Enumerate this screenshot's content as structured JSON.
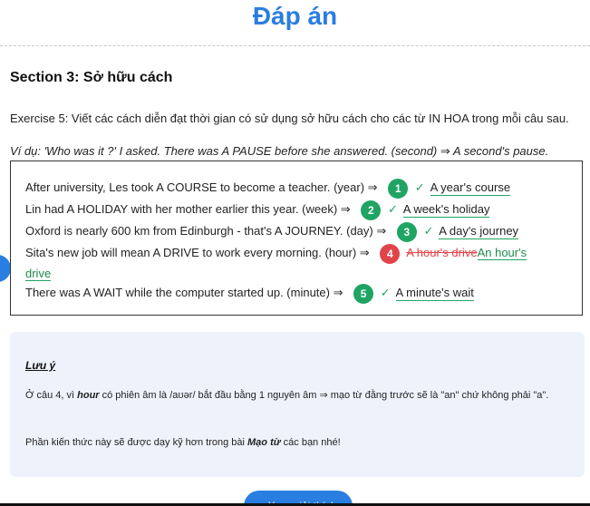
{
  "page": {
    "title": "Đáp án"
  },
  "section": {
    "title": "Section 3: Sở hữu cách"
  },
  "exercise": {
    "instruction": "Exercise 5: Viết các cách diễn đạt thời gian có sử dụng sở hữu cách cho các từ IN HOA trong mỗi câu sau.",
    "example": "Ví dụ: 'Who was it ?' I asked. There was A PAUSE before she answered. (second) ⇒ A second's pause."
  },
  "answers": [
    {
      "number": "1",
      "question": "After university, Les took A COURSE to become a teacher. (year) ⇒",
      "status": "correct",
      "answer": "A year's course"
    },
    {
      "number": "2",
      "question": "Lin had A HOLIDAY with her mother earlier this year. (week) ⇒",
      "status": "correct",
      "answer": "A week's holiday"
    },
    {
      "number": "3",
      "question": "Oxford is nearly 600 km from Edinburgh - that's A JOURNEY. (day) ⇒",
      "status": "correct",
      "answer": "A day's journey"
    },
    {
      "number": "4",
      "question": "Sita's new job will mean A DRIVE to work every morning. (hour) ⇒",
      "status": "wrong",
      "wrong_answer": "A hour's drive",
      "correct_answer_part1": "An hour's",
      "correct_answer_part2": "drive"
    },
    {
      "number": "5",
      "question": "There was A WAIT while the computer started up. (minute) ⇒",
      "status": "correct",
      "answer": "A minute's wait"
    }
  ],
  "note": {
    "heading": "Lưu ý",
    "p1_before": "Ở câu 4, vì ",
    "p1_bold": "hour",
    "p1_after": " có phiên âm là /aʊər/ bắt đầu bằng 1 nguyên âm ⇒ mạo từ đằng trước sẽ là \"an\" chứ không phải \"a\".",
    "p2_before": "Phần kiến thức này sẽ được dạy kỹ hơn trong bài ",
    "p2_bold": "Mạo từ",
    "p2_after": " các bạn nhé!"
  },
  "actions": {
    "explain_label": "↓ Xem giải thích"
  },
  "colors": {
    "accent": "#2a7de1",
    "correct": "#1fa463",
    "wrong": "#e0444a",
    "note_bg": "#eef3fb"
  },
  "icons": {
    "check": "check-icon"
  }
}
